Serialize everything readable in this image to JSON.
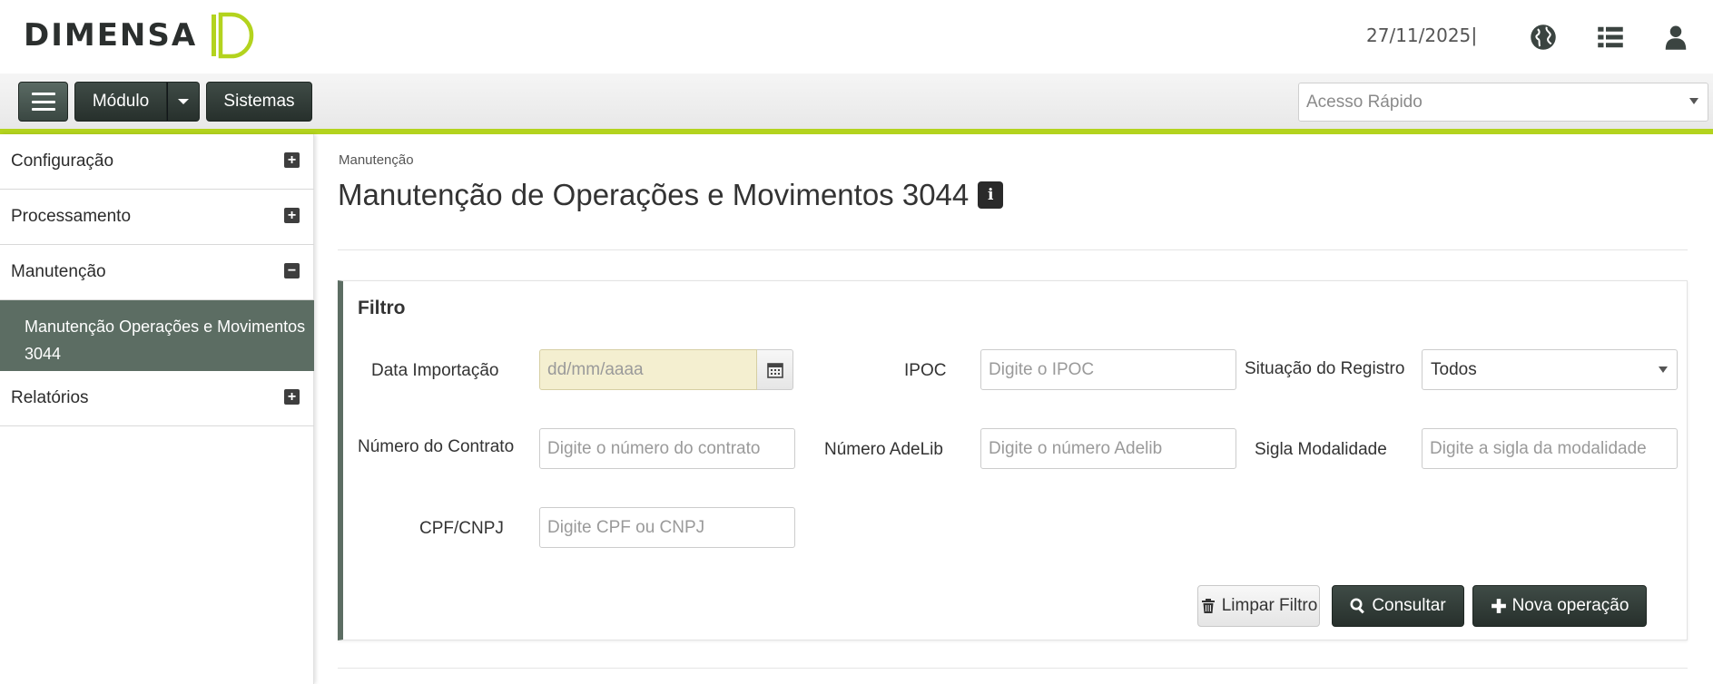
{
  "header": {
    "logo_text": "DIMENSA",
    "date": "27/11/2025",
    "separator": "|",
    "icons": [
      "globe-icon",
      "list-icon",
      "user-icon"
    ]
  },
  "toolbar": {
    "modulo_label": "Módulo",
    "sistemas_label": "Sistemas",
    "quick_access_placeholder": "Acesso Rápido"
  },
  "sidebar": {
    "items": [
      {
        "label": "Configuração",
        "toggle": "+"
      },
      {
        "label": "Processamento",
        "toggle": "+"
      },
      {
        "label": "Manutenção",
        "toggle": "−"
      },
      {
        "label": "Relatórios",
        "toggle": "+"
      }
    ],
    "active_sub": "Manutenção Operações e Movimentos 3044"
  },
  "main": {
    "breadcrumb": "Manutenção",
    "title": "Manutenção de Operações e Movimentos 3044",
    "info_glyph": "i"
  },
  "filter": {
    "title": "Filtro",
    "fields": {
      "data_importacao": {
        "label": "Data Importação",
        "placeholder": "dd/mm/aaaa"
      },
      "ipoc": {
        "label": "IPOC",
        "placeholder": "Digite o IPOC"
      },
      "situacao": {
        "label": "Situação do Registro",
        "value": "Todos"
      },
      "numero_contrato": {
        "label": "Número do Contrato",
        "placeholder": "Digite o número do contrato"
      },
      "numero_adelib": {
        "label": "Número AdeLib",
        "placeholder": "Digite o número Adelib"
      },
      "sigla_modalidade": {
        "label": "Sigla Modalidade",
        "placeholder": "Digite a sigla da modalidade"
      },
      "cpf_cnpj": {
        "label": "CPF/CNPJ",
        "placeholder": "Digite CPF ou CNPJ"
      }
    },
    "buttons": {
      "clear": "Limpar Filtro",
      "consult": "Consultar",
      "new": "Nova operação"
    }
  },
  "colors": {
    "accent_green": "#b3d31e",
    "dark_button": "#2f3a35",
    "sidebar_active": "#5c6d63",
    "date_field_bg": "#f4efd0"
  }
}
